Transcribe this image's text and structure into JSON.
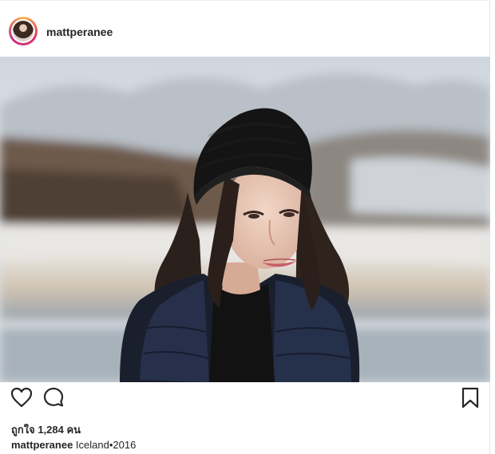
{
  "post": {
    "username": "mattperanee",
    "likes_text": "ถูกใจ 1,284 คน",
    "caption_user": "mattperanee",
    "caption_text": " Iceland•2016"
  },
  "icons": {
    "like": "heart-outline-icon",
    "comment": "speech-bubble-icon",
    "save": "bookmark-icon"
  },
  "colors": {
    "text": "#262626",
    "border": "#e6e6e6",
    "avatar_ring": "#e1306c"
  }
}
